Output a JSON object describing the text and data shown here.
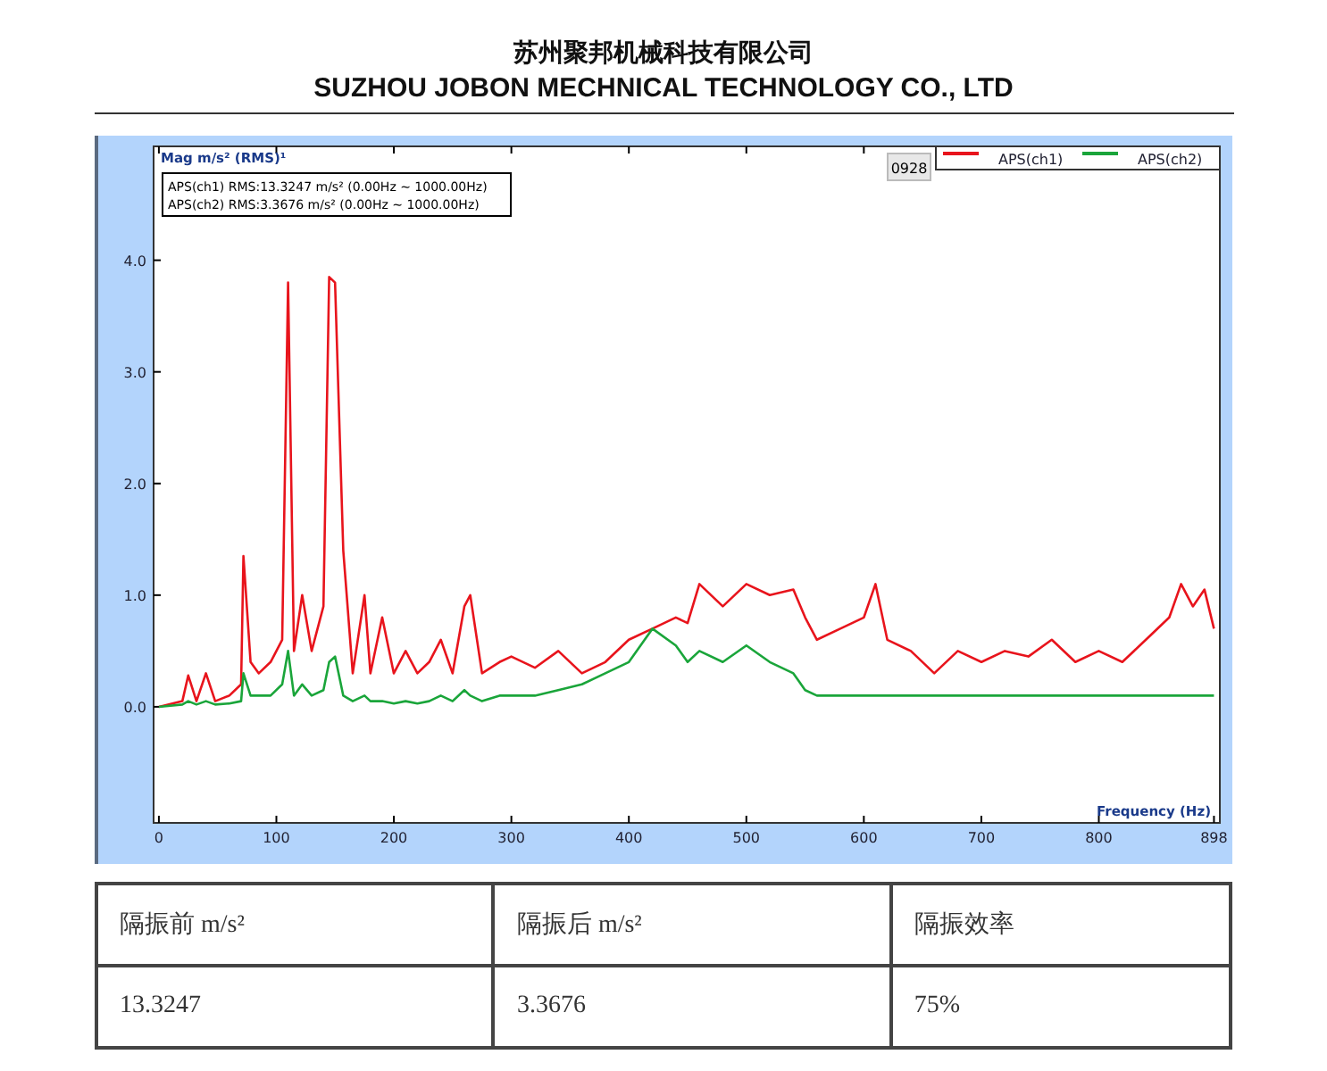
{
  "header": {
    "title_cn": "苏州聚邦机械科技有限公司",
    "title_en": "SUZHOU JOBON MECHNICAL TECHNOLOGY CO., LTD"
  },
  "chart": {
    "info_lines": [
      "APS(ch1) RMS:13.3247 m/s²   (0.00Hz ~ 1000.00Hz)",
      "APS(ch2) RMS:3.3676 m/s²   (0.00Hz ~ 1000.00Hz)"
    ],
    "badge": "0928",
    "chart_data": {
      "type": "line",
      "legend": true,
      "xlabel": "Frequency (Hz)",
      "ylabel": "Mag m/s² (RMS)¹",
      "xlim": [
        -4.5,
        903
      ],
      "ylim": [
        -1.04,
        5.02
      ],
      "xticks": [
        0,
        100,
        200,
        300,
        400,
        500,
        600,
        700,
        800,
        898
      ],
      "yticks": [
        {
          "value": 0,
          "label": "0.0"
        },
        {
          "value": 1,
          "label": "1.0"
        },
        {
          "value": 2,
          "label": "2.0"
        },
        {
          "value": 3,
          "label": "3.0"
        },
        {
          "value": 4,
          "label": "4.0"
        }
      ],
      "x": [
        0,
        20,
        25,
        32,
        40,
        48,
        60,
        70,
        72,
        78,
        85,
        95,
        105,
        110,
        115,
        122,
        130,
        140,
        145,
        150,
        157,
        165,
        175,
        180,
        190,
        200,
        210,
        220,
        230,
        240,
        250,
        260,
        265,
        275,
        290,
        300,
        320,
        340,
        360,
        380,
        400,
        420,
        440,
        450,
        460,
        480,
        500,
        520,
        540,
        550,
        560,
        580,
        600,
        610,
        620,
        640,
        660,
        680,
        700,
        720,
        740,
        760,
        780,
        800,
        820,
        840,
        860,
        870,
        880,
        890,
        898
      ],
      "series": [
        {
          "name": "APS(ch1)",
          "color": "#e8141c",
          "values": [
            0,
            0.05,
            0.28,
            0.05,
            0.3,
            0.05,
            0.1,
            0.2,
            1.35,
            0.4,
            0.3,
            0.4,
            0.6,
            3.8,
            0.5,
            1.0,
            0.5,
            0.9,
            3.85,
            3.8,
            1.4,
            0.3,
            1.0,
            0.3,
            0.8,
            0.3,
            0.5,
            0.3,
            0.4,
            0.6,
            0.3,
            0.9,
            1.0,
            0.3,
            0.4,
            0.45,
            0.35,
            0.5,
            0.3,
            0.4,
            0.6,
            0.7,
            0.8,
            0.75,
            1.1,
            0.9,
            1.1,
            1.0,
            1.05,
            0.8,
            0.6,
            0.7,
            0.8,
            1.1,
            0.6,
            0.5,
            0.3,
            0.5,
            0.4,
            0.5,
            0.45,
            0.6,
            0.4,
            0.5,
            0.4,
            0.6,
            0.8,
            1.1,
            0.9,
            1.05,
            0.7
          ]
        },
        {
          "name": "APS(ch2)",
          "color": "#1aa53a",
          "values": [
            0,
            0.02,
            0.05,
            0.02,
            0.05,
            0.02,
            0.03,
            0.05,
            0.3,
            0.1,
            0.1,
            0.1,
            0.2,
            0.5,
            0.1,
            0.2,
            0.1,
            0.15,
            0.4,
            0.45,
            0.1,
            0.05,
            0.1,
            0.05,
            0.05,
            0.03,
            0.05,
            0.03,
            0.05,
            0.1,
            0.05,
            0.15,
            0.1,
            0.05,
            0.1,
            0.1,
            0.1,
            0.15,
            0.2,
            0.3,
            0.4,
            0.7,
            0.55,
            0.4,
            0.5,
            0.4,
            0.55,
            0.4,
            0.3,
            0.15,
            0.1,
            0.1,
            0.1,
            0.1,
            0.1,
            0.1,
            0.1,
            0.1,
            0.1,
            0.1,
            0.1,
            0.1,
            0.1,
            0.1,
            0.1,
            0.1,
            0.1,
            0.1,
            0.1,
            0.1,
            0.1
          ]
        }
      ]
    }
  },
  "table": {
    "columns": [
      "隔振前 m/s²",
      "隔振后 m/s²",
      "隔振效率"
    ],
    "rows": [
      [
        "13.3247",
        "3.3676",
        "75%"
      ]
    ]
  }
}
